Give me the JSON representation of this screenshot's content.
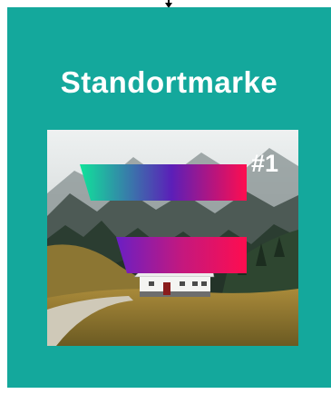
{
  "card": {
    "title": "Standortmarke",
    "background_color": "#14a89c",
    "title_color": "#ffffff"
  },
  "connector": {
    "icon": "arrow-down-icon"
  },
  "image": {
    "badge_text": "#1",
    "gradient_colors": [
      "#10e39a",
      "#5b1fb8",
      "#ff0d4f"
    ]
  }
}
